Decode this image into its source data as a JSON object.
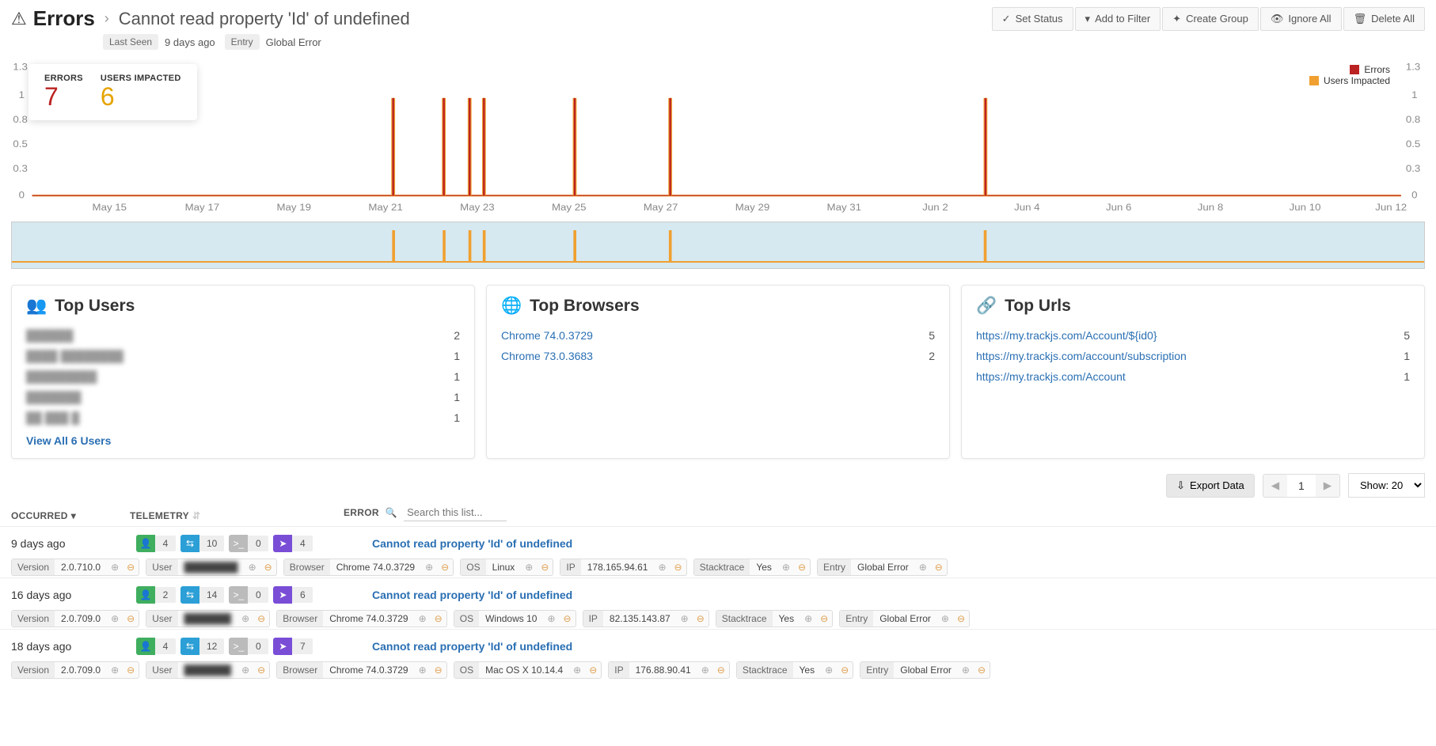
{
  "header": {
    "title": "Errors",
    "subtitle": "Cannot read property 'Id' of undefined",
    "last_seen_label": "Last Seen",
    "last_seen_value": "9 days ago",
    "entry_label": "Entry",
    "entry_value": "Global Error"
  },
  "actions": {
    "set_status": "Set Status",
    "add_filter": "Add to Filter",
    "create_group": "Create Group",
    "ignore_all": "Ignore All",
    "delete_all": "Delete All"
  },
  "stats": {
    "errors_label": "ERRORS",
    "errors_value": "7",
    "users_label": "USERS IMPACTED",
    "users_value": "6"
  },
  "legend": {
    "errors": "Errors",
    "users": "Users Impacted"
  },
  "chart_data": {
    "type": "bar",
    "x_ticks": [
      "May 15",
      "May 17",
      "May 19",
      "May 21",
      "May 23",
      "May 25",
      "May 27",
      "May 29",
      "May 31",
      "Jun 2",
      "Jun 4",
      "Jun 6",
      "Jun 8",
      "Jun 10",
      "Jun 12"
    ],
    "y_range_errors": [
      0,
      1.3
    ],
    "y_range_users": [
      0,
      1.3
    ],
    "y_ticks": [
      "0",
      "0.3",
      "0.5",
      "0.8",
      "1",
      "1.3"
    ],
    "series": [
      {
        "name": "Errors",
        "color": "#b22",
        "spikes_at": [
          "May 21",
          "May 22",
          "May 23",
          "May 23.5",
          "May 25",
          "May 27",
          "Jun 3"
        ],
        "value": 1
      },
      {
        "name": "Users Impacted",
        "color": "#f0a030",
        "spikes_at": [
          "May 21",
          "May 22",
          "May 23",
          "May 23.5",
          "May 25",
          "May 27",
          "Jun 3"
        ],
        "value": 1
      }
    ]
  },
  "cards": {
    "top_users": {
      "title": "Top Users",
      "rows": [
        {
          "name": "██████",
          "count": "2"
        },
        {
          "name": "████ ████████",
          "count": "1"
        },
        {
          "name": "█████████",
          "count": "1"
        },
        {
          "name": "███████",
          "count": "1"
        },
        {
          "name": "██ ███ █",
          "count": "1"
        }
      ],
      "view_all": "View All 6 Users"
    },
    "top_browsers": {
      "title": "Top Browsers",
      "rows": [
        {
          "name": "Chrome 74.0.3729",
          "count": "5"
        },
        {
          "name": "Chrome 73.0.3683",
          "count": "2"
        }
      ]
    },
    "top_urls": {
      "title": "Top Urls",
      "rows": [
        {
          "name": "https://my.trackjs.com/Account/${id0}",
          "count": "5"
        },
        {
          "name": "https://my.trackjs.com/account/subscription",
          "count": "1"
        },
        {
          "name": "https://my.trackjs.com/Account",
          "count": "1"
        }
      ]
    }
  },
  "list": {
    "col_occurred": "OCCURRED",
    "col_telemetry": "TELEMETRY",
    "col_error": "ERROR",
    "search_placeholder": "Search this list...",
    "export": "Export Data",
    "page": "1",
    "show_label": "Show: 20"
  },
  "errors": [
    {
      "occurred": "9 days ago",
      "badges": {
        "user": "4",
        "net": "10",
        "console": "0",
        "nav": "4"
      },
      "message": "Cannot read property 'Id' of undefined",
      "tags": [
        {
          "label": "Version",
          "value": "2.0.710.0"
        },
        {
          "label": "User",
          "value": "████████"
        },
        {
          "label": "Browser",
          "value": "Chrome 74.0.3729"
        },
        {
          "label": "OS",
          "value": "Linux"
        },
        {
          "label": "IP",
          "value": "178.165.94.61"
        },
        {
          "label": "Stacktrace",
          "value": "Yes"
        },
        {
          "label": "Entry",
          "value": "Global Error"
        }
      ]
    },
    {
      "occurred": "16 days ago",
      "badges": {
        "user": "2",
        "net": "14",
        "console": "0",
        "nav": "6"
      },
      "message": "Cannot read property 'Id' of undefined",
      "tags": [
        {
          "label": "Version",
          "value": "2.0.709.0"
        },
        {
          "label": "User",
          "value": "███████"
        },
        {
          "label": "Browser",
          "value": "Chrome 74.0.3729"
        },
        {
          "label": "OS",
          "value": "Windows 10"
        },
        {
          "label": "IP",
          "value": "82.135.143.87"
        },
        {
          "label": "Stacktrace",
          "value": "Yes"
        },
        {
          "label": "Entry",
          "value": "Global Error"
        }
      ]
    },
    {
      "occurred": "18 days ago",
      "badges": {
        "user": "4",
        "net": "12",
        "console": "0",
        "nav": "7"
      },
      "message": "Cannot read property 'Id' of undefined",
      "tags": [
        {
          "label": "Version",
          "value": "2.0.709.0"
        },
        {
          "label": "User",
          "value": "███████"
        },
        {
          "label": "Browser",
          "value": "Chrome 74.0.3729"
        },
        {
          "label": "OS",
          "value": "Mac OS X 10.14.4"
        },
        {
          "label": "IP",
          "value": "176.88.90.41"
        },
        {
          "label": "Stacktrace",
          "value": "Yes"
        },
        {
          "label": "Entry",
          "value": "Global Error"
        }
      ]
    }
  ]
}
